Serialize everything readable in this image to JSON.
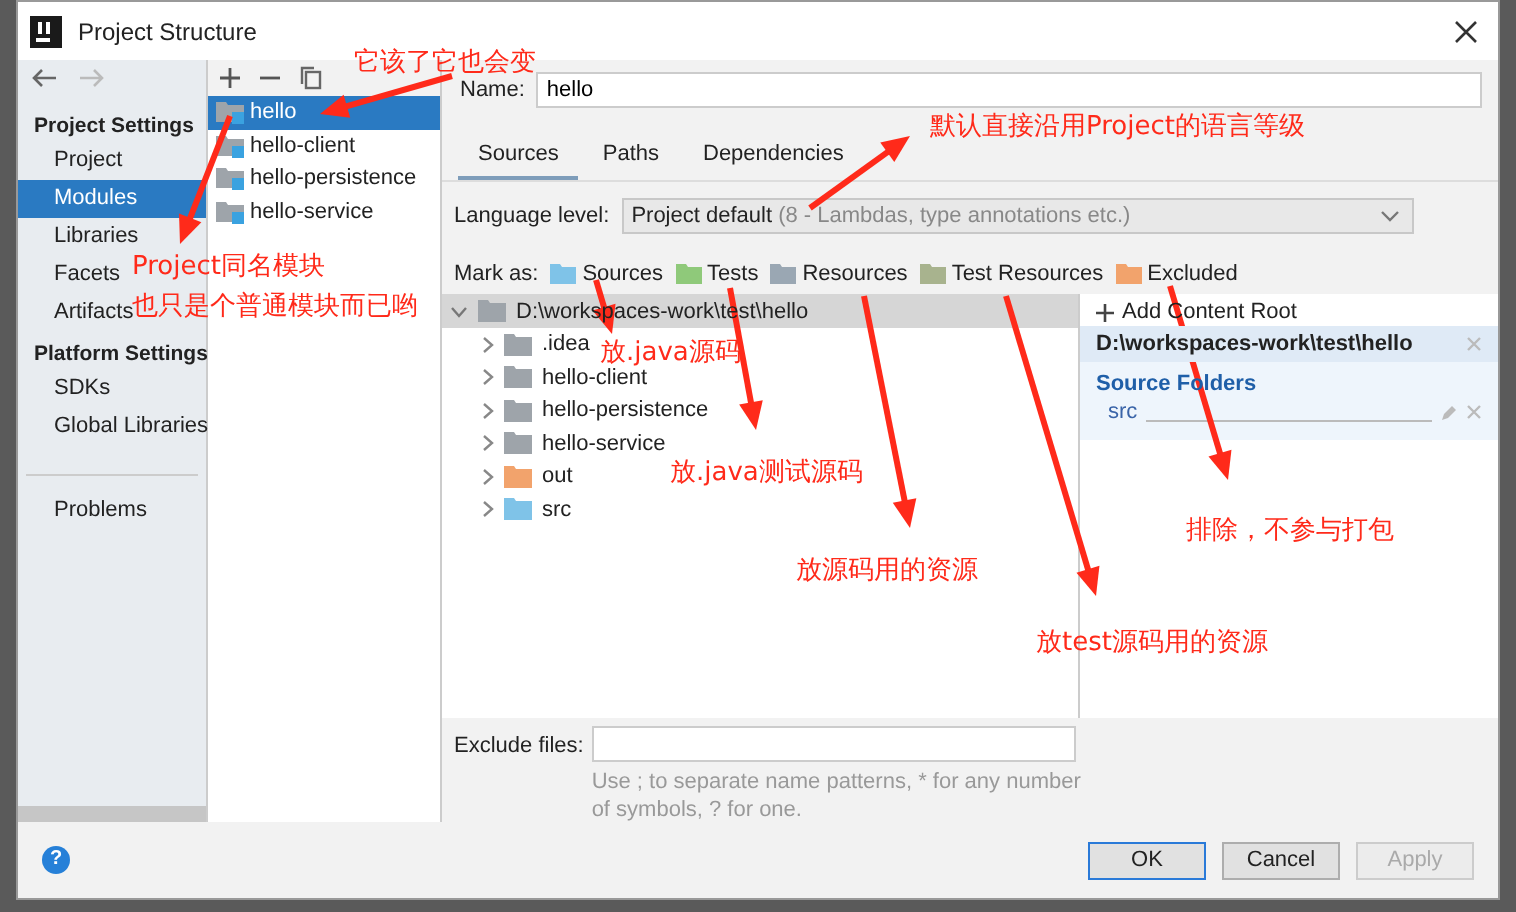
{
  "window": {
    "title": "Project Structure"
  },
  "sidebar": {
    "sections": [
      {
        "heading": "Project Settings",
        "items": [
          {
            "label": "Project",
            "selected": false
          },
          {
            "label": "Modules",
            "selected": true
          },
          {
            "label": "Libraries",
            "selected": false
          },
          {
            "label": "Facets",
            "selected": false
          },
          {
            "label": "Artifacts",
            "selected": false
          }
        ]
      },
      {
        "heading": "Platform Settings",
        "items": [
          {
            "label": "SDKs",
            "selected": false
          },
          {
            "label": "Global Libraries",
            "selected": false
          }
        ]
      }
    ],
    "problems": "Problems"
  },
  "modules": [
    {
      "name": "hello",
      "selected": true
    },
    {
      "name": "hello-client",
      "selected": false
    },
    {
      "name": "hello-persistence",
      "selected": false
    },
    {
      "name": "hello-service",
      "selected": false
    }
  ],
  "name_field": {
    "label": "Name:",
    "value": "hello"
  },
  "tabs": [
    {
      "label": "Sources",
      "selected": true
    },
    {
      "label": "Paths",
      "selected": false
    },
    {
      "label": "Dependencies",
      "selected": false
    }
  ],
  "language_level": {
    "label": "Language level:",
    "value": "Project default",
    "hint": "(8 - Lambdas, type annotations etc.)"
  },
  "mark_as": {
    "label": "Mark as:",
    "options": [
      {
        "label": "Sources",
        "kind": "sources"
      },
      {
        "label": "Tests",
        "kind": "tests"
      },
      {
        "label": "Resources",
        "kind": "resources"
      },
      {
        "label": "Test Resources",
        "kind": "test_resources"
      },
      {
        "label": "Excluded",
        "kind": "excluded"
      }
    ]
  },
  "tree": {
    "label": "D:\\workspaces-work\\test\\hello",
    "expanded": true,
    "children": [
      {
        "label": ".idea",
        "kind": "folder",
        "expanded": false
      },
      {
        "label": "hello-client",
        "kind": "folder",
        "expanded": false
      },
      {
        "label": "hello-persistence",
        "kind": "folder",
        "expanded": false
      },
      {
        "label": "hello-service",
        "kind": "folder",
        "expanded": false
      },
      {
        "label": "out",
        "kind": "excluded",
        "expanded": false
      },
      {
        "label": "src",
        "kind": "sources",
        "expanded": false
      }
    ]
  },
  "content_root": {
    "add_label": "Add Content Root",
    "path": "D:\\workspaces-work\\test\\hello",
    "source_heading": "Source Folders",
    "source_folders": [
      "src"
    ]
  },
  "exclude_files": {
    "label": "Exclude files:",
    "hint": "Use ; to separate name patterns, * for any number of symbols, ? for one."
  },
  "help_button": "?",
  "buttons": [
    {
      "label": "OK",
      "disabled": false,
      "default": true
    },
    {
      "label": "Cancel",
      "disabled": false,
      "default": false
    },
    {
      "label": "Apply",
      "disabled": true,
      "default": false
    }
  ],
  "annotations": [
    {
      "text": "它该了它也会变"
    },
    {
      "text": "Project同名模块"
    },
    {
      "text": "也只是个普通模块而已哟"
    },
    {
      "text": "默认直接沿用Project的语言等级"
    },
    {
      "text": "放.java源码"
    },
    {
      "text": "放.java测试源码"
    },
    {
      "text": "放源码用的资源"
    },
    {
      "text": "排除，不参与打包"
    },
    {
      "text": "放test源码用的资源"
    }
  ]
}
